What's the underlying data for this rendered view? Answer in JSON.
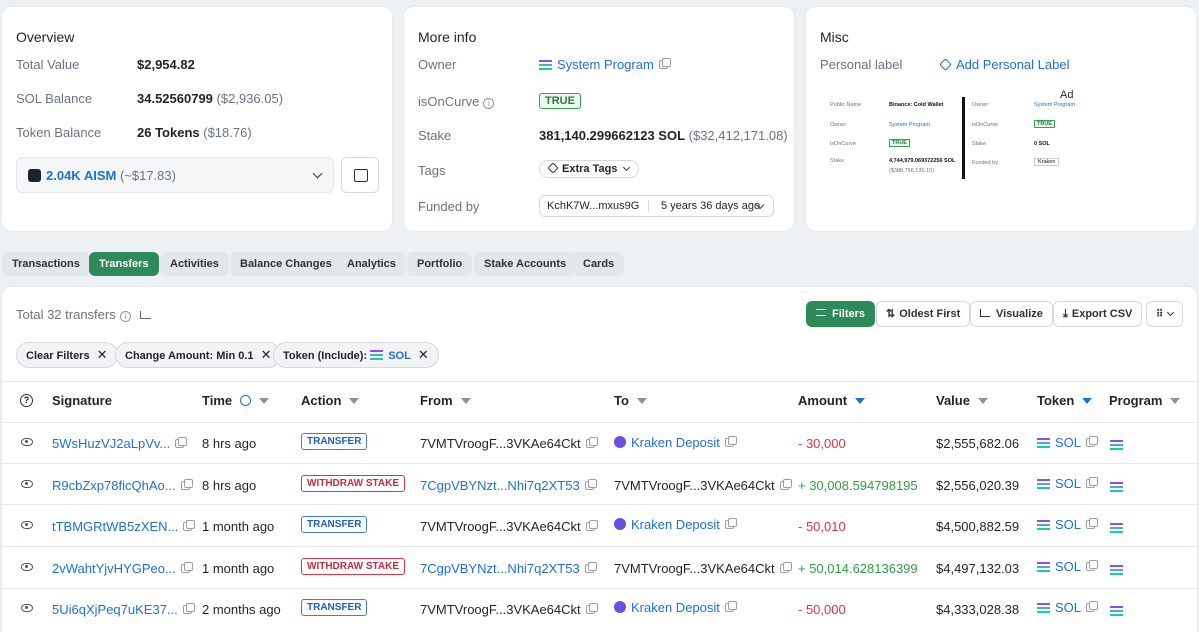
{
  "overview": {
    "title": "Overview",
    "total_value_label": "Total Value",
    "total_value": "$2,954.82",
    "sol_balance_label": "SOL Balance",
    "sol_balance": "34.52560799",
    "sol_balance_usd": "($2,936.05)",
    "token_balance_label": "Token Balance",
    "token_balance": "26 Tokens",
    "token_balance_usd": "($18.76)",
    "token_select_amount": "2.04K AISM",
    "token_select_usd": "(~$17.83)"
  },
  "more_info": {
    "title": "More info",
    "owner_label": "Owner",
    "owner_value": "System Program",
    "is_on_curve_label": "isOnCurve",
    "is_on_curve_value": "TRUE",
    "stake_label": "Stake",
    "stake_value": "381,140.299662123 SOL",
    "stake_usd": "($32,412,171.08)",
    "tags_label": "Tags",
    "tags_button": "Extra Tags",
    "funded_by_label": "Funded by",
    "funded_by_address": "KchK7W...mxus9G",
    "funded_by_time": "5 years 36 days ago"
  },
  "misc": {
    "title": "Misc",
    "personal_label_label": "Personal label",
    "add_personal_label": "Add Personal Label",
    "ad_label": "Ad",
    "ad": {
      "public_name_label": "Public Name",
      "public_name_value": "Binance: Cold Wallet",
      "owner_label": "Owner",
      "owner_value": "System Program",
      "is_on_curve_label": "isOnCurve",
      "is_on_curve_value": "TRUE",
      "stake_label": "Stake",
      "stake_value": "4,744,979.069372256 SOL",
      "stake_usd": "($388,756,135.15)",
      "r_owner_label": "Owner",
      "r_owner_value": "System Program",
      "r_curve_label": "isOnCurve",
      "r_curve_value": "TRUE",
      "r_stake_label": "Stake",
      "r_stake_value": "0 SOL",
      "r_funded_label": "Funded by",
      "r_funded_value": "Kraken"
    }
  },
  "tabs": [
    "Transactions",
    "Transfers",
    "Activities",
    "Balance Changes",
    "Analytics",
    "Portfolio",
    "Stake Accounts",
    "Cards"
  ],
  "toolbar": {
    "total": "Total 32 transfers",
    "filters": "Filters",
    "oldest_first": "Oldest First",
    "visualize": "Visualize",
    "export_csv": "Export CSV"
  },
  "chips": {
    "clear": "Clear Filters",
    "change_amount_label": "Change Amount:",
    "change_amount_value": "Min 0.1",
    "token_label": "Token (Include):",
    "token_value": "SOL"
  },
  "columns": {
    "signature": "Signature",
    "time": "Time",
    "action": "Action",
    "from": "From",
    "to": "To",
    "amount": "Amount",
    "value": "Value",
    "token": "Token",
    "program": "Program"
  },
  "rows": [
    {
      "signature": "5WsHuzVJ2aLpVv...",
      "time": "8 hrs ago",
      "action": "TRANSFER",
      "from": "7VMTVroogF...3VKAe64Ckt",
      "to": "Kraken Deposit",
      "amount": "- 30,000",
      "value": "$2,555,682.06",
      "token": "SOL"
    },
    {
      "signature": "R9cbZxp78ficQhAo...",
      "time": "8 hrs ago",
      "action": "WITHDRAW STAKE",
      "from": "7CgpVBYNzt...Nhi7q2XT53",
      "to": "7VMTVroogF...3VKAe64Ckt",
      "amount": "+ 30,008.594798195",
      "value": "$2,556,020.39",
      "token": "SOL"
    },
    {
      "signature": "tTBMGRtWB5zXEN...",
      "time": "1 month ago",
      "action": "TRANSFER",
      "from": "7VMTVroogF...3VKAe64Ckt",
      "to": "Kraken Deposit",
      "amount": "- 50,010",
      "value": "$4,500,882.59",
      "token": "SOL"
    },
    {
      "signature": "2vWahtYjvHYGPeo...",
      "time": "1 month ago",
      "action": "WITHDRAW STAKE",
      "from": "7CgpVBYNzt...Nhi7q2XT53",
      "to": "7VMTVroogF...3VKAe64Ckt",
      "amount": "+ 50,014.628136399",
      "value": "$4,497,132.03",
      "token": "SOL"
    },
    {
      "signature": "5Ui6qXjPeq7uKE37...",
      "time": "2 months ago",
      "action": "TRANSFER",
      "from": "7VMTVroogF...3VKAe64Ckt",
      "to": "Kraken Deposit",
      "amount": "- 50,000",
      "value": "$4,333,028.38",
      "token": "SOL"
    }
  ]
}
